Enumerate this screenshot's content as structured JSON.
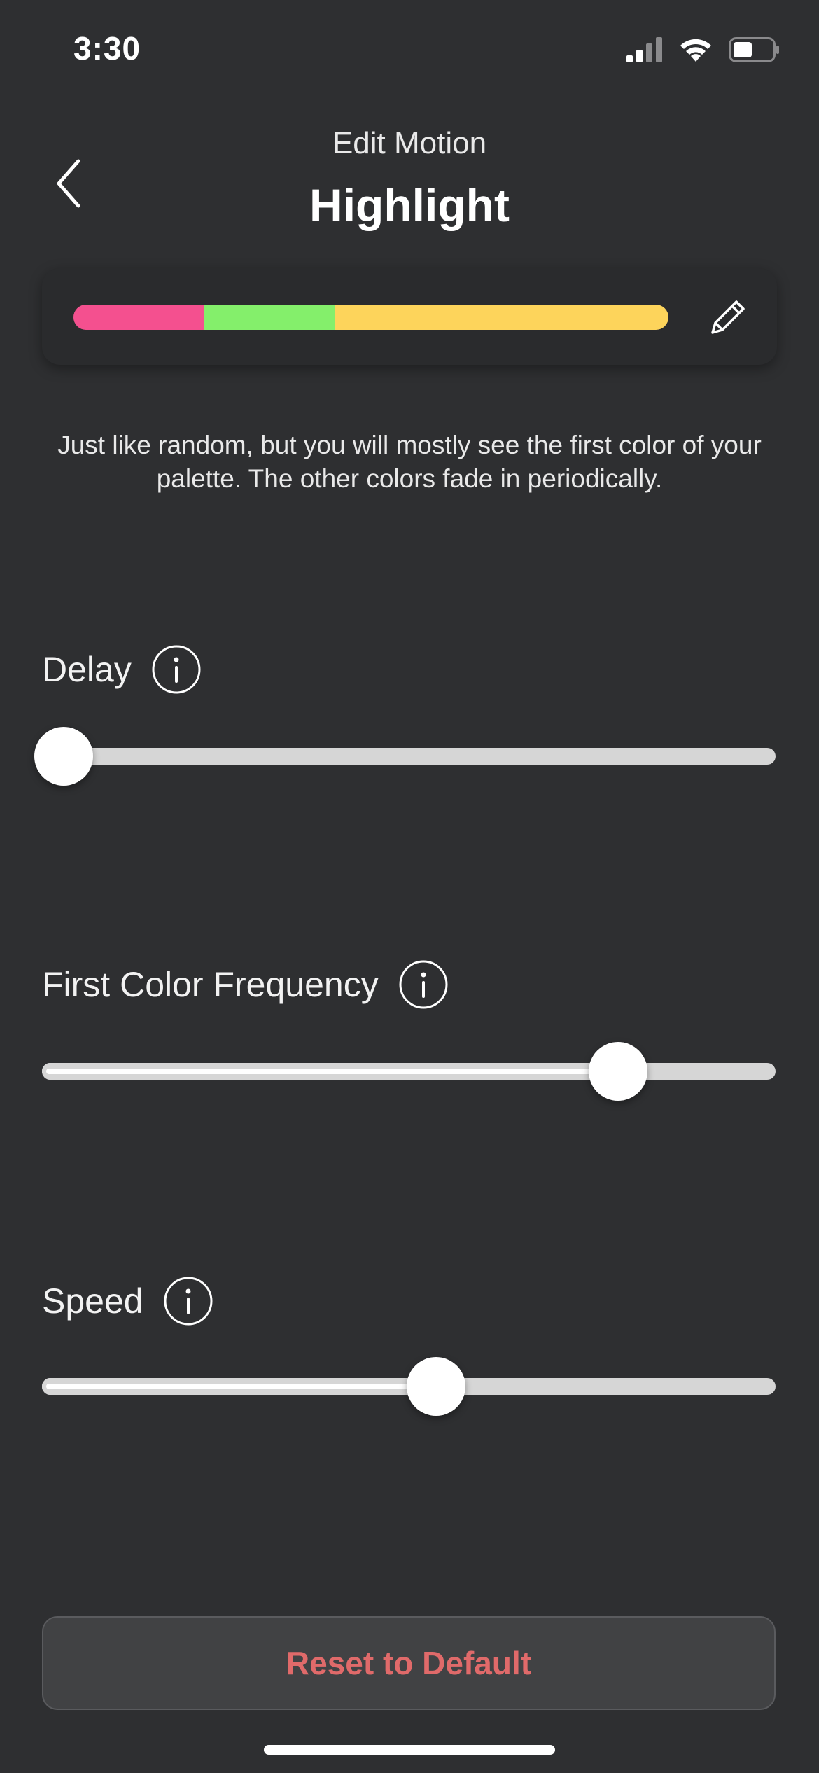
{
  "status_bar": {
    "time": "3:30"
  },
  "header": {
    "subtitle": "Edit Motion",
    "title": "Highlight"
  },
  "palette": {
    "colors": [
      "#f4508f",
      "#84ef6b",
      "#fdd45b"
    ],
    "segments": [
      0.22,
      0.22,
      0.56
    ]
  },
  "description": "Just like random, but you will mostly see the first color of your palette. The other colors fade in periodically.",
  "sliders": [
    {
      "label": "Delay",
      "value": 0.03
    },
    {
      "label": "First Color Frequency",
      "value": 0.785
    },
    {
      "label": "Speed",
      "value": 0.537
    }
  ],
  "reset_button": {
    "label": "Reset to Default"
  },
  "colors": {
    "background": "#2e2f31",
    "reset_text": "#e06a6a"
  },
  "icons": {
    "back": "chevron-left-icon",
    "edit": "pencil-icon",
    "info": "info-icon"
  }
}
